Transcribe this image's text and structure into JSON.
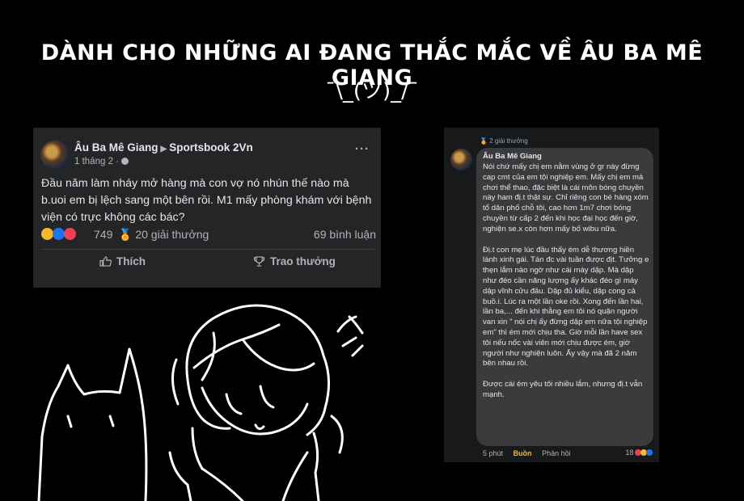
{
  "headline": "DÀNH CHO NHỮNG AI ĐANG THẮC MẮC VỀ ÂU BA MÊ GIANG",
  "shrug": "¯\\_(ツ)_/¯",
  "post": {
    "author": "Âu Ba Mê Giang",
    "group": "Sportsbook 2Vn",
    "time": "1 tháng 2 ·",
    "text": "Đầu năm làm nháy mở hàng mà con vợ nó nhún thế nào mà b.uoi em bị lệch sang một bên rồi. M1 mấy phòng khám với bệnh viện có trực không các bác?",
    "reaction_count": "749",
    "awards": "20 giải thưởng",
    "comments": "69 bình luận",
    "like_label": "Thích",
    "award_label": "Trao thưởng",
    "reaction_colors": [
      "#f7b928",
      "#1877f2",
      "#f33e58"
    ]
  },
  "comment": {
    "award_tag": "2 giải thưởng",
    "author": "Âu Ba Mê Giang",
    "paragraphs": [
      "Nói chứ mấy chị em nằm vùng ở gr này đừng cap cmt của em tội nghiệp em. Mấy chị em mà chơi thể thao, đặc biệt là cái môn bóng chuyền này ham đị.t thật sự. Chỉ riêng con bé hàng xóm tổ dân phố chỗ tôi, cao hơn 1m7 chơi bóng chuyền từ cấp 2 đến khi học đại học đến giờ, nghiện se.x còn hơn mấy bố wibu nữa.",
      "Đị.t con mẹ lúc đầu thấy ém dễ thương hiền lành xinh gái. Tán đc vài tuần được địt. Tưởng e thẹn lắm nào ngờ như cái máy dập. Mà dập như đéo cần năng lượng ấy khác đéo gì máy dập vĩnh cửu đâu. Dập đủ kiểu, dập cong cả buồ.i. Lúc ra một lần oke rồi. Xong đến lần hai, lần ba,... đến khi thằng em tôi nó quặn người van xin \" nói chị ấy đừng dập em nữa tội nghiệp em\" thì ém mới chịu tha. Giờ mỗi lần have sex tôi nếu nốc vài viên mới chịu được ém, giờ người như nghiện luôn. Ấy vậy mà đã 2 năm bên nhau rồi.",
      "Được cái ém yêu tôi nhiều lắm, nhưng đị.t vẫn mạnh."
    ],
    "time": "5 phút",
    "reaction_label": "Buồn",
    "reply_label": "Phản hồi",
    "reaction_count": "18",
    "reaction_colors": [
      "#f33e58",
      "#f7b928",
      "#1877f2"
    ]
  }
}
